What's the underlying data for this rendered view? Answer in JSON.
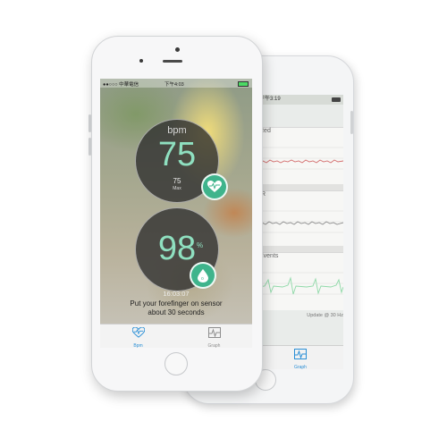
{
  "front": {
    "status": {
      "carrier": "●●○○○ 中華電信",
      "time": "下午4:03",
      "battery": "▬"
    },
    "heart": {
      "unit_label": "bpm",
      "value": "75",
      "sub_value": "75",
      "sub_label": "Max"
    },
    "oxygen": {
      "value": "98",
      "unit": "%"
    },
    "timestamp": "16:03:07",
    "instruction_line1": "Put your forefinger on sensor",
    "instruction_line2": "about 30 seconds",
    "tabs": [
      {
        "label": "Bpm",
        "icon": "heart-pulse-icon",
        "active": true
      },
      {
        "label": "Graph",
        "icon": "graph-icon",
        "active": false
      }
    ]
  },
  "back": {
    "status": {
      "time": "下午3:19"
    },
    "sections": [
      {
        "label": "Red"
      },
      {
        "label": "IR"
      },
      {
        "label": "Events"
      }
    ],
    "footer_text": "Update @ 30 Hz",
    "tab": {
      "label": "Graph",
      "icon": "graph-icon"
    }
  },
  "colors": {
    "accent": "#3fb48c",
    "value_text": "#8fe0c0",
    "tab_active": "#2a8fd6",
    "red_wave": "#d36a6a",
    "ir_wave": "#8a8a8a",
    "event_wave": "#8fd9a8"
  }
}
